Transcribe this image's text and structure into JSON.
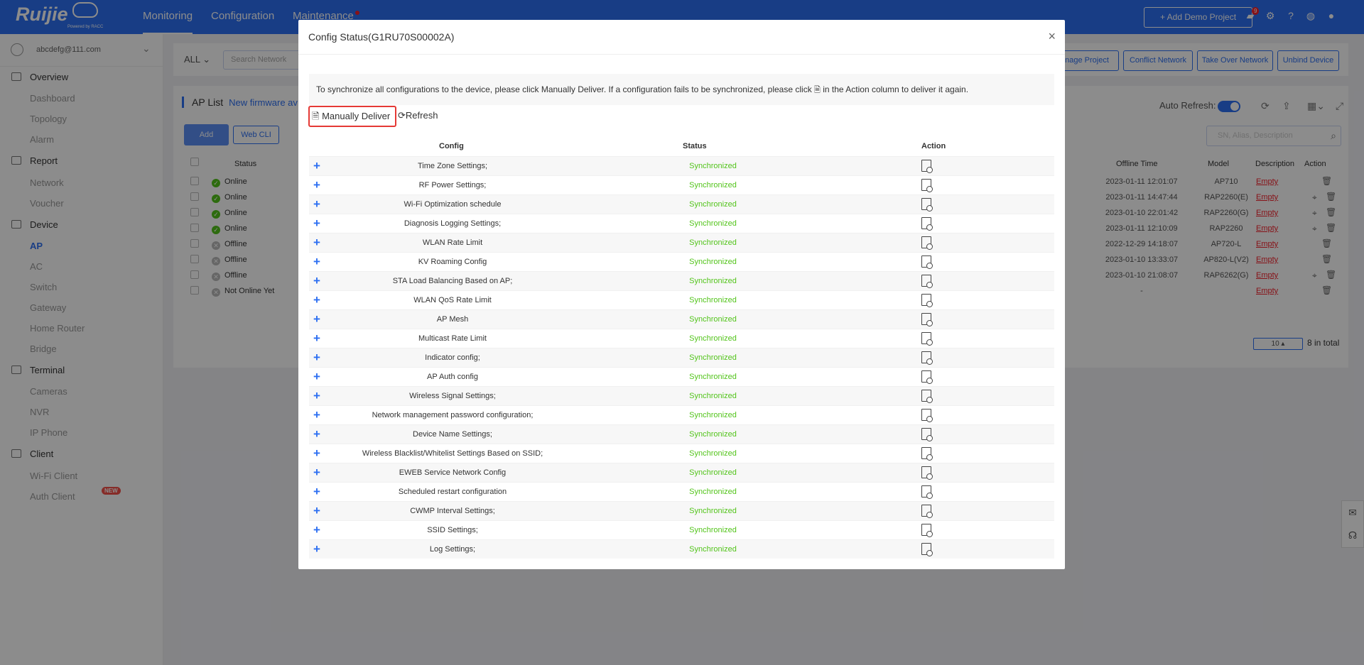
{
  "header": {
    "logo_text": "Ruijie",
    "logo_sub": "Powered by RACC",
    "nav": [
      "Monitoring",
      "Configuration",
      "Maintenance"
    ],
    "demo_button": "+ Add Demo Project",
    "badge_count": "9"
  },
  "sidebar": {
    "user": "abcdefg@111.com",
    "groups": [
      {
        "label": "Overview",
        "items": [
          "Dashboard",
          "Topology",
          "Alarm"
        ]
      },
      {
        "label": "Report",
        "items": [
          "Network",
          "Voucher"
        ]
      },
      {
        "label": "Device",
        "items": [
          "AP",
          "AC",
          "Switch",
          "Gateway",
          "Home Router",
          "Bridge"
        ]
      },
      {
        "label": "Terminal",
        "items": [
          "Cameras",
          "NVR",
          "IP Phone"
        ]
      },
      {
        "label": "Client",
        "items": [
          "Wi-Fi Client",
          "Auth Client"
        ]
      }
    ],
    "active_item": "AP",
    "new_tag": "NEW"
  },
  "toolbar": {
    "filter": "ALL",
    "search_placeholder": "Search Network",
    "buttons": [
      "nage Project",
      "Conflict Network",
      "Take Over Network",
      "Unbind Device"
    ]
  },
  "ap_list": {
    "title": "AP List",
    "firmware_link": "New firmware av",
    "add_label": "Add",
    "webcli_label": "Web CLI",
    "auto_refresh_label": "Auto Refresh:",
    "search_placeholder": "SN, Alias, Description",
    "columns": {
      "status": "Status",
      "offline_time": "Offline Time",
      "model": "Model",
      "description": "Description",
      "action": "Action"
    },
    "rows": [
      {
        "status": "Online",
        "offline": "2023-01-11 12:01:07",
        "model": "AP710",
        "desc": "Empty"
      },
      {
        "status": "Online",
        "offline": "2023-01-11 14:47:44",
        "model": "RAP2260(E)",
        "desc": "Empty"
      },
      {
        "status": "Online",
        "offline": "2023-01-10 22:01:42",
        "model": "RAP2260(G)",
        "desc": "Empty"
      },
      {
        "status": "Online",
        "offline": "2023-01-11 12:10:09",
        "model": "RAP2260",
        "desc": "Empty"
      },
      {
        "status": "Offline",
        "offline": "2022-12-29 14:18:07",
        "model": "AP720-L",
        "desc": "Empty"
      },
      {
        "status": "Offline",
        "offline": "2023-01-10 13:33:07",
        "model": "AP820-L(V2)",
        "desc": "Empty"
      },
      {
        "status": "Offline",
        "offline": "2023-01-10 21:08:07",
        "model": "RAP6262(G)",
        "desc": "Empty"
      },
      {
        "status": "Not Online Yet",
        "offline": "-",
        "model": "",
        "desc": "Empty"
      }
    ],
    "page_size": "10",
    "total": "8 in total"
  },
  "modal": {
    "title": "Config Status(G1RU70S00002A)",
    "notice_before": "To synchronize all configurations to the device, please click Manually Deliver. If a configuration fails to be synchronized, please click",
    "notice_after": "in the Action column to deliver it again.",
    "deliver_label": "Manually Deliver",
    "refresh_label": "Refresh",
    "columns": {
      "config": "Config",
      "status": "Status",
      "action": "Action"
    },
    "rows": [
      {
        "config": "Time Zone Settings;",
        "status": "Synchronized"
      },
      {
        "config": "RF Power Settings;",
        "status": "Synchronized"
      },
      {
        "config": "Wi-Fi Optimization schedule",
        "status": "Synchronized"
      },
      {
        "config": "Diagnosis Logging Settings;",
        "status": "Synchronized"
      },
      {
        "config": "WLAN Rate Limit",
        "status": "Synchronized"
      },
      {
        "config": "KV Roaming Config",
        "status": "Synchronized"
      },
      {
        "config": "STA Load Balancing Based on AP;",
        "status": "Synchronized"
      },
      {
        "config": "WLAN QoS Rate Limit",
        "status": "Synchronized"
      },
      {
        "config": "AP Mesh",
        "status": "Synchronized"
      },
      {
        "config": "Multicast Rate Limit",
        "status": "Synchronized"
      },
      {
        "config": "Indicator config;",
        "status": "Synchronized"
      },
      {
        "config": "AP Auth config",
        "status": "Synchronized"
      },
      {
        "config": "Wireless Signal Settings;",
        "status": "Synchronized"
      },
      {
        "config": "Network management password configuration;",
        "status": "Synchronized"
      },
      {
        "config": "Device Name Settings;",
        "status": "Synchronized"
      },
      {
        "config": "Wireless Blacklist/Whitelist Settings Based on SSID;",
        "status": "Synchronized"
      },
      {
        "config": "EWEB Service Network Config",
        "status": "Synchronized"
      },
      {
        "config": "Scheduled restart configuration",
        "status": "Synchronized"
      },
      {
        "config": "CWMP Interval Settings;",
        "status": "Synchronized"
      },
      {
        "config": "SSID Settings;",
        "status": "Synchronized"
      },
      {
        "config": "Log Settings;",
        "status": "Synchronized"
      }
    ]
  },
  "colors": {
    "brand": "#2d6ff2",
    "synced": "#52c41a",
    "highlight": "#e53935"
  }
}
